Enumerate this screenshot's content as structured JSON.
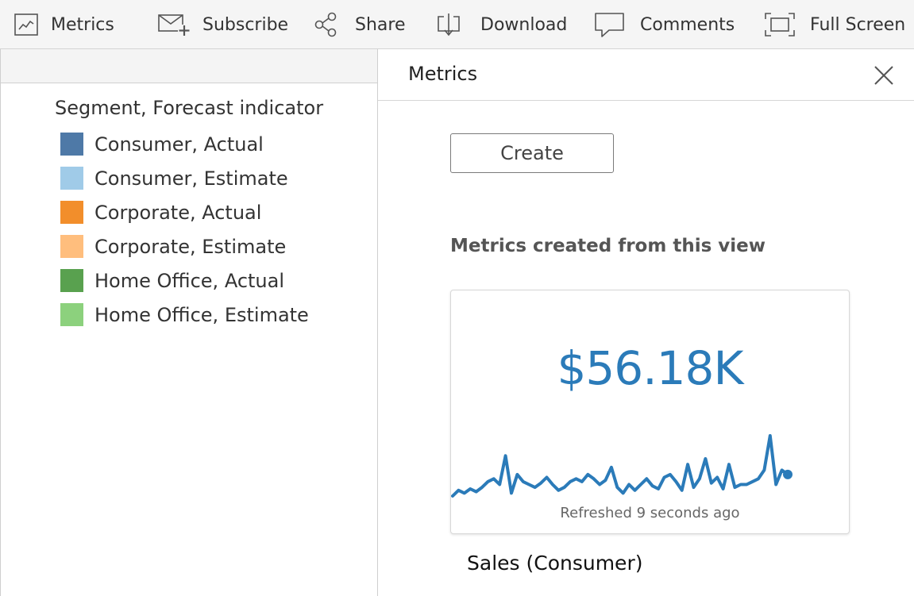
{
  "toolbar": {
    "metrics_label": "Metrics",
    "subscribe_label": "Subscribe",
    "share_label": "Share",
    "download_label": "Download",
    "comments_label": "Comments",
    "fullscreen_label": "Full Screen",
    "icons": [
      "line-chart-icon",
      "envelope-plus-icon",
      "share-nodes-icon",
      "download-tray-icon",
      "speech-bubble-icon",
      "fullscreen-icon"
    ]
  },
  "legend": {
    "title": "Segment, Forecast indicator",
    "items": [
      {
        "label": "Consumer, Actual",
        "color": "#4e79a7"
      },
      {
        "label": "Consumer, Estimate",
        "color": "#a0cbe8"
      },
      {
        "label": "Corporate, Actual",
        "color": "#f28e2b"
      },
      {
        "label": "Corporate, Estimate",
        "color": "#ffbe7d"
      },
      {
        "label": "Home Office, Actual",
        "color": "#59a14f"
      },
      {
        "label": "Home Office, Estimate",
        "color": "#8cd17d"
      }
    ]
  },
  "panel": {
    "title": "Metrics",
    "close_icon": "close-icon",
    "create_label": "Create",
    "section_title": "Metrics created from this view",
    "metric": {
      "value": "$56.18K",
      "refreshed": "Refreshed 9 seconds ago",
      "name": "Sales (Consumer)",
      "accent_color": "#2b7bb9",
      "sparkline": [
        40,
        44,
        42,
        45,
        43,
        46,
        50,
        52,
        48,
        68,
        42,
        55,
        50,
        48,
        46,
        49,
        53,
        48,
        44,
        46,
        50,
        52,
        50,
        55,
        52,
        48,
        51,
        60,
        46,
        42,
        48,
        44,
        48,
        52,
        47,
        45,
        53,
        55,
        50,
        44,
        62,
        46,
        52,
        66,
        49,
        53,
        45,
        62,
        46,
        48,
        48,
        50,
        52,
        58,
        82,
        48,
        58,
        55
      ]
    }
  }
}
